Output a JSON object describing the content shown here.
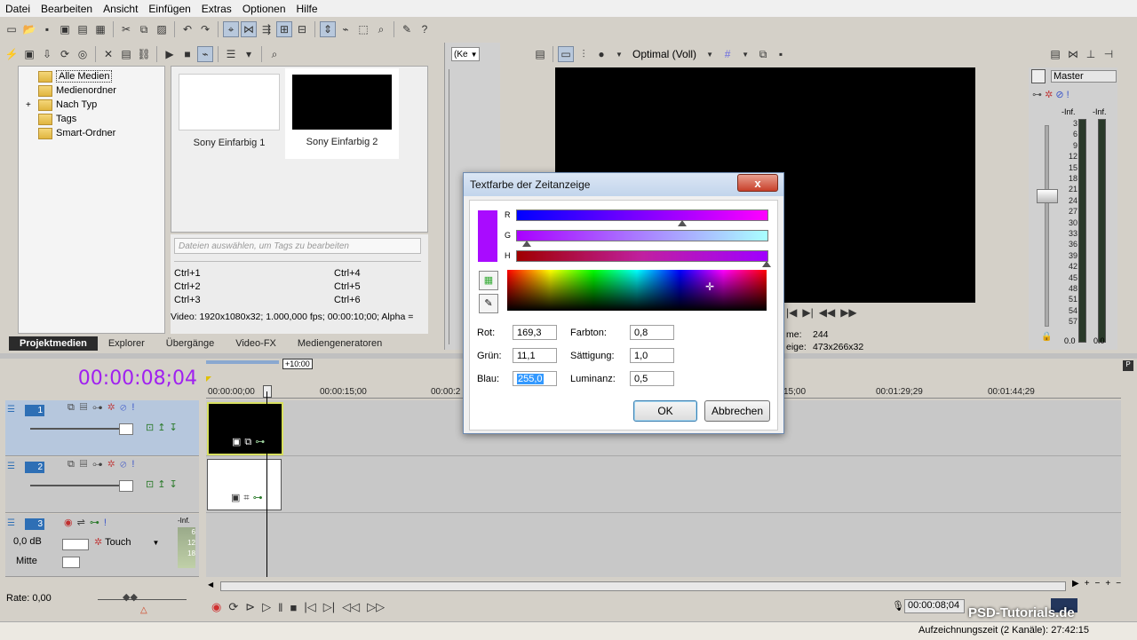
{
  "menu": [
    "Datei",
    "Bearbeiten",
    "Ansicht",
    "Einfügen",
    "Extras",
    "Optionen",
    "Hilfe"
  ],
  "media_tree": [
    "Alle Medien",
    "Medienordner",
    "Nach Typ",
    "Tags",
    "Smart-Ordner"
  ],
  "media_items": [
    {
      "label": "Sony Einfarbig 1",
      "color": "#ffffff"
    },
    {
      "label": "Sony Einfarbig 2",
      "color": "#000000"
    }
  ],
  "tags_placeholder": "Dateien auswählen, um Tags zu bearbeiten",
  "shortcuts": [
    "Ctrl+1",
    "Ctrl+4",
    "Ctrl+2",
    "Ctrl+5",
    "Ctrl+3",
    "Ctrl+6"
  ],
  "media_info": "Video: 1920x1080x32; 1.000,000 fps; 00:00:10;00; Alpha =",
  "bottom_tabs": [
    "Projektmedien",
    "Explorer",
    "Übergänge",
    "Video-FX",
    "Mediengeneratoren"
  ],
  "trimmer_dropdown": "(Ke",
  "preview_quality": "Optimal (Voll)",
  "preview_info": {
    "frame_label": "me:",
    "frame": "244",
    "display_label": "eige:",
    "display": "473x266x32"
  },
  "master": {
    "label": "Master",
    "left": "-Inf.",
    "right": "-Inf.",
    "scale": [
      "3",
      "6",
      "9",
      "12",
      "15",
      "18",
      "21",
      "24",
      "27",
      "30",
      "33",
      "36",
      "39",
      "42",
      "45",
      "48",
      "51",
      "54",
      "57"
    ],
    "bottom_left": "0.0",
    "bottom_right": "0.0"
  },
  "timecode": "00:00:08;04",
  "loop_region": "+10:00",
  "ruler": [
    "00:00:00;00",
    "00:00:15;00",
    "00:00:2",
    "15;00",
    "00:01:29;29",
    "00:01:44;29"
  ],
  "tracks": [
    {
      "num": "1",
      "type": "video"
    },
    {
      "num": "2",
      "type": "video"
    },
    {
      "num": "3",
      "type": "audio",
      "volume": "0,0 dB",
      "mode": "Touch",
      "pan": "Mitte",
      "meter": [
        "-Inf.",
        "6",
        "12",
        "18"
      ]
    }
  ],
  "rate": "Rate: 0,00",
  "transport_time": "00:00:08;04",
  "status": "Aufzeichnungszeit (2 Kanäle): 27:42:15",
  "watermark": "PSD-Tutorials.de",
  "dialog": {
    "title": "Textfarbe der Zeitanzeige",
    "close": "x",
    "swatch_color": "#a90bff",
    "slider_labels": [
      "R",
      "G",
      "H"
    ],
    "labels": {
      "rot": "Rot:",
      "gruen": "Grün:",
      "blau": "Blau:",
      "farbton": "Farbton:",
      "saettigung": "Sättigung:",
      "luminanz": "Luminanz:"
    },
    "values": {
      "rot": "169,3",
      "gruen": "11,1",
      "blau": "255,0",
      "farbton": "0,8",
      "saettigung": "1,0",
      "luminanz": "0,5"
    },
    "ok": "OK",
    "cancel": "Abbrechen"
  }
}
